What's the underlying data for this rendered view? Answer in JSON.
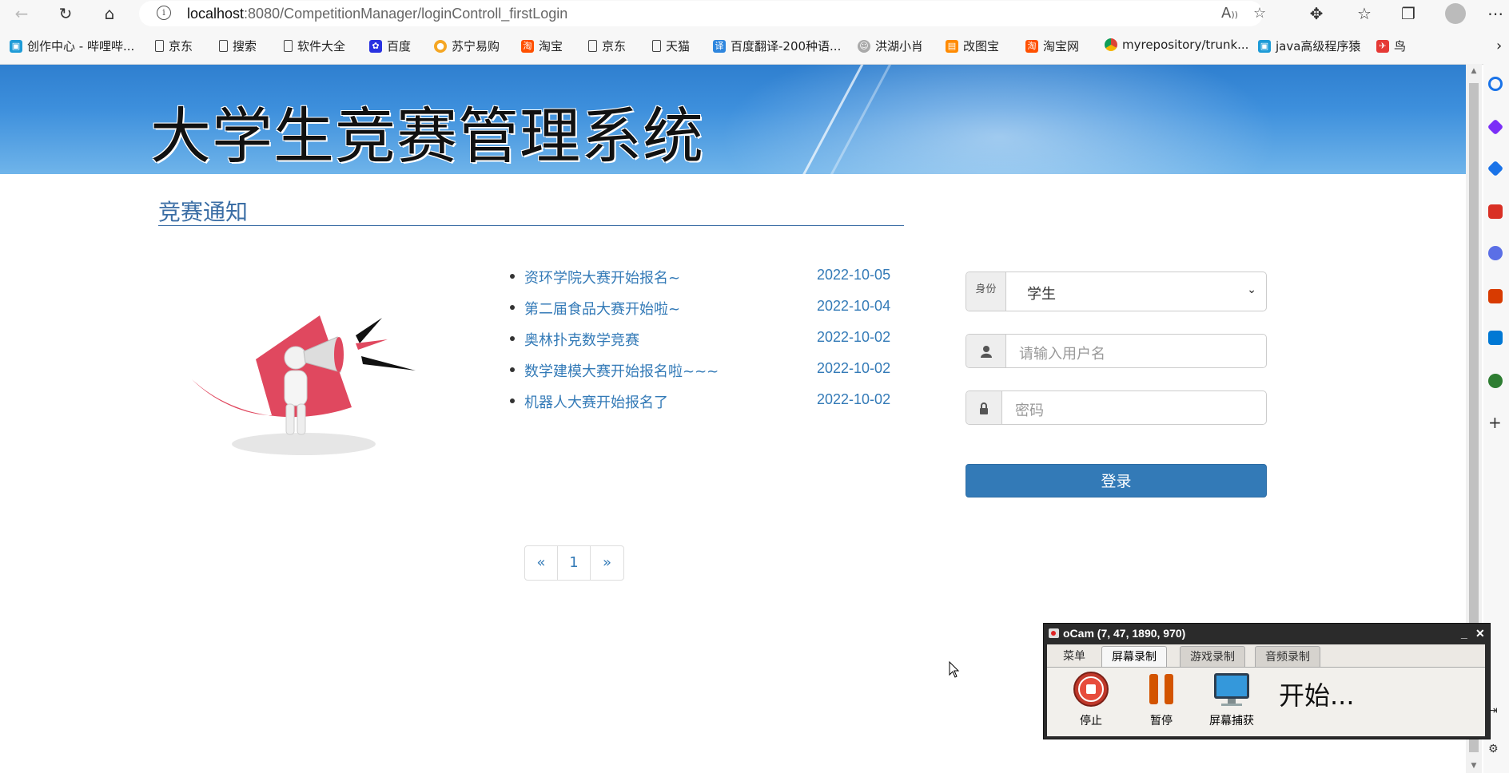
{
  "browser": {
    "url_host": "localhost",
    "url_rest": ":8080/CompetitionManager/loginControll_firstLogin",
    "bookmarks": [
      {
        "label": "创作中心 - 哔哩哔...",
        "icon": "bilibili-icon"
      },
      {
        "label": "京东",
        "icon": "page-icon"
      },
      {
        "label": "搜索",
        "icon": "page-icon"
      },
      {
        "label": "软件大全",
        "icon": "page-icon"
      },
      {
        "label": "百度",
        "icon": "baidu-icon"
      },
      {
        "label": "苏宁易购",
        "icon": "suning-icon"
      },
      {
        "label": "淘宝",
        "icon": "taobao-icon"
      },
      {
        "label": "京东",
        "icon": "page-icon"
      },
      {
        "label": "天猫",
        "icon": "page-icon"
      },
      {
        "label": "百度翻译-200种语...",
        "icon": "baidu-translate-icon"
      },
      {
        "label": "洪湖小肖",
        "icon": "avatar-icon"
      },
      {
        "label": "改图宝",
        "icon": "gaitubao-icon"
      },
      {
        "label": "淘宝网",
        "icon": "taobao-icon"
      },
      {
        "label": "myrepository/trunk...",
        "icon": "chrome-icon"
      },
      {
        "label": "java高级程序猿",
        "icon": "bilibili-icon"
      },
      {
        "label": "鸟",
        "icon": "bird-icon"
      }
    ],
    "more_bookmarks": "›"
  },
  "page": {
    "system_title": "大学生竞赛管理系统",
    "notice_heading": "竞赛通知",
    "news": [
      {
        "title": "资环学院大赛开始报名~",
        "date": "2022-10-05"
      },
      {
        "title": "第二届食品大赛开始啦~",
        "date": "2022-10-04"
      },
      {
        "title": "奥林扑克数学竞赛",
        "date": "2022-10-02"
      },
      {
        "title": "数学建模大赛开始报名啦~~~",
        "date": "2022-10-02"
      },
      {
        "title": "机器人大赛开始报名了",
        "date": "2022-10-02"
      }
    ],
    "pagination": {
      "prev": "«",
      "current": "1",
      "next": "»"
    }
  },
  "login": {
    "role_label": "身份",
    "role_value": "学生",
    "username_placeholder": "请输入用户名",
    "password_placeholder": "密码",
    "submit_label": "登录"
  },
  "ocam": {
    "title": "oCam (7, 47, 1890, 970)",
    "tabs": [
      "菜单",
      "屏幕录制",
      "游戏录制",
      "音频录制"
    ],
    "active_tab": "屏幕录制",
    "tools": [
      "停止",
      "暂停",
      "屏幕捕获"
    ],
    "status": "开始..."
  }
}
